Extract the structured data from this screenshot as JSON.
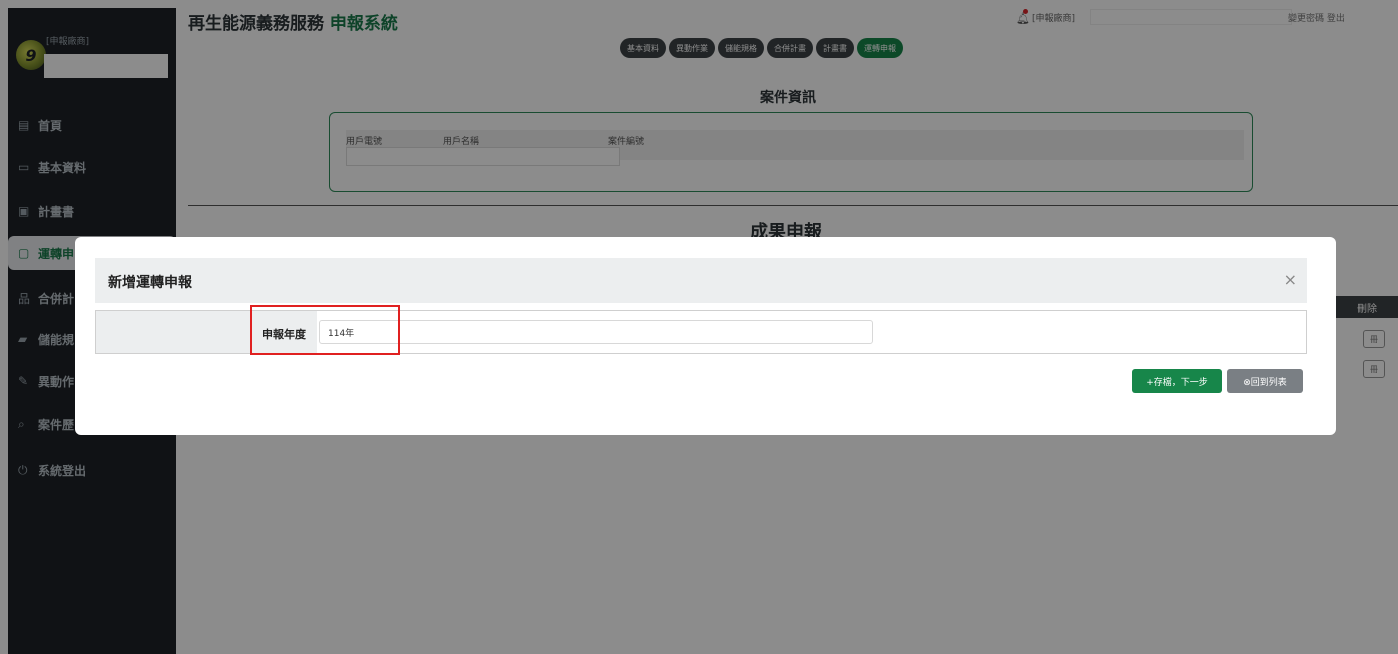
{
  "sidebar": {
    "role": "[申報廠商]",
    "items": [
      {
        "label": "首頁",
        "icon": "document-icon"
      },
      {
        "label": "基本資料",
        "icon": "folder-icon"
      },
      {
        "label": "計畫書",
        "icon": "file-icon"
      },
      {
        "label": "運轉申",
        "icon": "clipboard-icon"
      },
      {
        "label": "合併計",
        "icon": "sitemap-icon"
      },
      {
        "label": "儲能規",
        "icon": "battery-icon"
      },
      {
        "label": "異動作",
        "icon": "edit-icon"
      },
      {
        "label": "案件歷",
        "icon": "search-icon"
      },
      {
        "label": "系統登出",
        "icon": "power-icon"
      }
    ]
  },
  "header": {
    "title_main": "再生能源義務服務",
    "title_sub": "申報系統",
    "vendor_label": "[申報廠商]",
    "links": "變更密碼 登出"
  },
  "tabs": [
    "基本資料",
    "異動作業",
    "儲能規格",
    "合併計畫",
    "計畫書",
    "運轉申報"
  ],
  "case_info": {
    "title": "案件資訊",
    "labels": [
      "用戶電號",
      "用戶名稱",
      "案件編號"
    ]
  },
  "results": {
    "title": "成果申報",
    "delete_header": "刪除",
    "delete_button": "冊"
  },
  "modal": {
    "title": "新增運轉申報",
    "close": "×",
    "field_label": "申報年度",
    "field_value": "114年",
    "save_button": "+存檔，下一步",
    "back_button": "⊗回到列表"
  }
}
